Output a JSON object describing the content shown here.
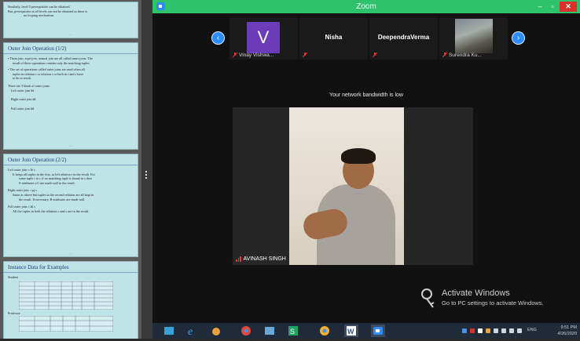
{
  "window": {
    "title": "Zoom"
  },
  "slides": [
    {
      "title": "",
      "lines": [
        "Similarly, level 0 prerequisites can be obtained.",
        "But, prerequisites at all levels can not be obtained as there is",
        "no looping mechanism."
      ]
    },
    {
      "title": "Outer Join Operation (1/2)",
      "lines": [
        "• Theta join, equi-join, natural join are all called inner joins. The",
        "result of these operations contain only the matching tuples",
        "• The set of operations called outer joins are used when all",
        "tuples in relation r or relation s or both in r and s have",
        "to be in result.",
        "There are 3 kinds of outer joins:",
        "Left outer join",
        "Right outer join",
        "Full outer join"
      ]
    },
    {
      "title": "Outer Join Operation (2/2)",
      "lines": [
        "Left outer join: r ⟕ s",
        "It keeps all tuples in the first, or left relation r in the result. For",
        "some tuple t in r, if no matching tuple is found in s then",
        "S-attributes of t are made null in the result.",
        "Right outer join: r ⟖ s",
        "Same as above but tuples in the second relation are all kept in",
        "the result. If necessary, R-attributes are made null.",
        "Full outer join: r ⟗ s",
        "All the tuples in both the relations r and s are in the result."
      ]
    },
    {
      "title": "Instance Data for Examples",
      "lines": [
        "Student",
        "Professor"
      ]
    }
  ],
  "participants": [
    {
      "label": "Vinay Vishwa...",
      "display": "V",
      "color": "#6b3bb8"
    },
    {
      "label": "",
      "display": "Nisha"
    },
    {
      "label": "",
      "display": "DeependraVerma"
    },
    {
      "label": "Surendra Ku...",
      "display": ""
    }
  ],
  "notice": "Your network bandwidth is low",
  "active_speaker": "AVINASH SINGH",
  "activate": {
    "line1": "Activate Windows",
    "line2": "Go to PC settings to activate Windows."
  },
  "tray": {
    "lang": "ENG",
    "time": "9:51 PM",
    "date": "4/26/2020"
  },
  "colors": {
    "titlebar": "#2dc26b",
    "accent": "#2d8cff",
    "close": "#d9302e"
  }
}
